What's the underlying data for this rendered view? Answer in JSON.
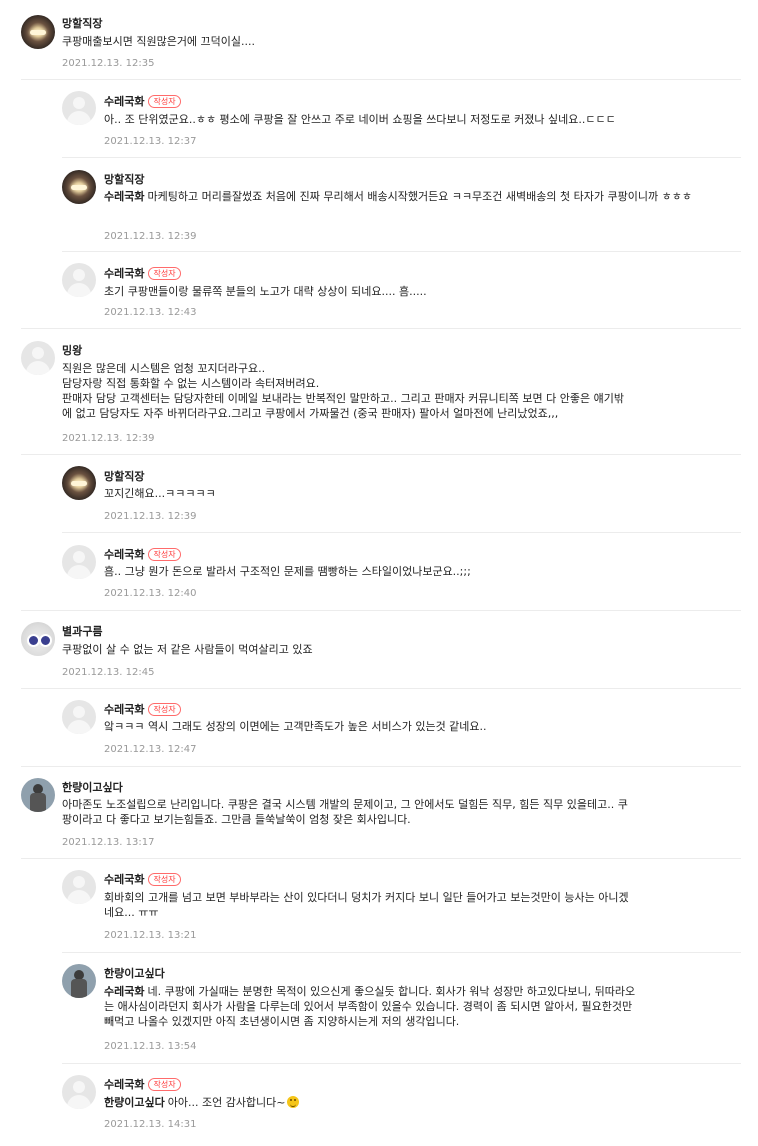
{
  "badge_label": "작성자",
  "comments": [
    {
      "nick": "망할직장",
      "text": "쿠팡매출보시면 직원많은거에 끄덕이실....",
      "date": "2021.12.13. 12:35"
    },
    {
      "nick": "수레국화",
      "text": "아.. 조 단위였군요..ㅎㅎ 평소에 쿠팡을 잘 안쓰고 주로 네이버 쇼핑을 쓰다보니 저정도로 커졌나 싶네요..ㄷㄷㄷ",
      "date": "2021.12.13. 12:37"
    },
    {
      "nick": "망할직장",
      "mention": "수레국화",
      "text": "마케팅하고 머리를잘썼죠 처음에 진짜 무리해서 배송시작했거든요 ㅋㅋ무조건 새벽배송의 첫 타자가 쿠팡이니까 ㅎㅎㅎ",
      "date": "2021.12.13. 12:39"
    },
    {
      "nick": "수레국화",
      "text": "초기 쿠팡맨들이랑 물류쪽 분들의 노고가 대략 상상이 되네요.... 흠.....",
      "date": "2021.12.13. 12:43"
    },
    {
      "nick": "밍왕",
      "lines": [
        "직원은 많은데 시스템은 엄청 꼬지더라구요..",
        "담당자랑 직접 통화할 수 없는 시스템이라 속터져버려요.",
        "판매자 담당 고객센터는 담당자한테 이메일 보내라는 반복적인 말만하고.. 그리고 판매자 커뮤니티쪽 보면 다 안좋은 얘기밖",
        "에 없고 담당자도 자주 바뀌더라구요.그리고 쿠팡에서 가짜물건 (중국 판매자) 팔아서 얼마전에 난리났었죠,,,"
      ],
      "date": "2021.12.13. 12:39"
    },
    {
      "nick": "망할직장",
      "text": "꼬지긴해요...ㅋㅋㅋㅋㅋ",
      "date": "2021.12.13. 12:39"
    },
    {
      "nick": "수레국화",
      "text": "흠.. 그냥 뭔가 돈으로 발라서 구조적인 문제를 땜빵하는 스타일이었나보군요..;;;",
      "date": "2021.12.13. 12:40"
    },
    {
      "nick": "별과구름",
      "text": "쿠팡없이 살 수 없는 저 같은 사람들이 먹여살리고 있죠",
      "date": "2021.12.13. 12:45"
    },
    {
      "nick": "수레국화",
      "text": "앜ㅋㅋㅋ 역시 그래도 성장의 이면에는 고객만족도가 높은 서비스가 있는것 같네요..",
      "date": "2021.12.13. 12:47"
    },
    {
      "nick": "한량이고싶다",
      "lines": [
        "아마존도 노조설립으로 난리입니다. 쿠팡은 결국 시스템 개발의 문제이고, 그 안에서도 덜힘든 직무, 힘든 직무 있을테고.. 쿠",
        "팡이라고 다 좋다고 보기는힘들죠. 그만큼 들쑥날쑥이 엄청 잦은 회사입니다."
      ],
      "date": "2021.12.13. 13:17"
    },
    {
      "nick": "수레국화",
      "lines": [
        "회바회의 고개를 넘고 보면 부바부라는 산이 있다더니 덩치가 커지다 보니 일단 들어가고 보는것만이 능사는 아니겠",
        "네요... ㅠㅠ"
      ],
      "date": "2021.12.13. 13:21"
    },
    {
      "nick": "한량이고싶다",
      "mention": "수레국화",
      "lines": [
        "네. 쿠팡에 가실때는 분명한 목적이 있으신게 좋으실듯 합니다. 회사가 워낙 성장만 하고있다보니, 뒤따라오",
        "는 애사심이라던지 회사가 사람을 다루는데 있어서 부족함이 있을수 있습니다. 경력이 좀 되시면 알아서, 필요한것만",
        "빼먹고 나올수 있겠지만 아직 초년생이시면 좀 지양하시는게 저의 생각입니다."
      ],
      "date": "2021.12.13. 13:54"
    },
    {
      "nick": "수레국화",
      "mention": "한량이고싶다",
      "text": "아아... 조언 감사합니다~",
      "date": "2021.12.13. 14:31"
    }
  ]
}
